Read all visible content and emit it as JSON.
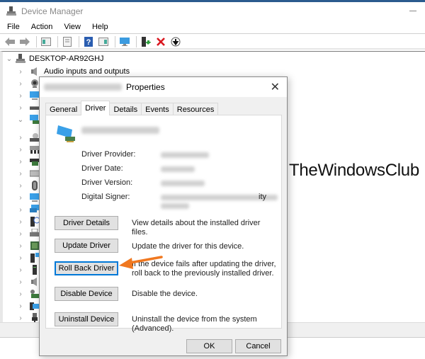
{
  "window": {
    "title": "Device Manager"
  },
  "menu": [
    "File",
    "Action",
    "View",
    "Help"
  ],
  "toolbar": [
    "back-icon",
    "forward-icon",
    "show-hide-console-tree-icon",
    "properties-icon",
    "help-icon",
    "action-pane-icon",
    "scan-hardware-icon",
    "update-driver-icon",
    "uninstall-icon",
    "disable-icon"
  ],
  "tree": {
    "root": "DESKTOP-AR92GHJ",
    "first_item": "Audio inputs and outputs",
    "items": [
      {
        "icon": "audio-icon",
        "expanded": false
      },
      {
        "icon": "camera-icon",
        "expanded": false
      },
      {
        "icon": "monitor-icon",
        "expanded": false
      },
      {
        "icon": "disk-drive-icon",
        "expanded": false
      },
      {
        "icon": "display-adapter-icon",
        "expanded": true
      },
      {
        "icon": "dvd-drive-icon",
        "expanded": false
      },
      {
        "icon": "hid-icon",
        "expanded": false
      },
      {
        "icon": "ide-controller-icon",
        "expanded": false
      },
      {
        "icon": "keyboard-icon",
        "expanded": false
      },
      {
        "icon": "mouse-icon",
        "expanded": false
      },
      {
        "icon": "monitors-icon",
        "expanded": false
      },
      {
        "icon": "network-adapter-icon",
        "expanded": false
      },
      {
        "icon": "other-devices-icon",
        "expanded": false
      },
      {
        "icon": "print-queue-icon",
        "expanded": false
      },
      {
        "icon": "processor-icon",
        "expanded": false
      },
      {
        "icon": "security-device-icon",
        "expanded": false
      },
      {
        "icon": "software-device-icon",
        "expanded": false
      },
      {
        "icon": "sound-icon",
        "expanded": false
      },
      {
        "icon": "storage-controller-icon",
        "expanded": false
      },
      {
        "icon": "system-device-icon",
        "expanded": false
      },
      {
        "icon": "usb-controller-icon",
        "expanded": false
      }
    ]
  },
  "dialog": {
    "title_suffix": "Properties",
    "tabs": [
      "General",
      "Driver",
      "Details",
      "Events",
      "Resources"
    ],
    "active_tab": "Driver",
    "props": [
      {
        "label": "Driver Provider:"
      },
      {
        "label": "Driver Date:"
      },
      {
        "label": "Driver Version:"
      },
      {
        "label": "Digital Signer:",
        "visible_tail": "ity"
      }
    ],
    "buttons": [
      {
        "label": "Driver Details",
        "desc": "View details about the installed driver files."
      },
      {
        "label": "Update Driver",
        "desc": "Update the driver for this device."
      },
      {
        "label": "Roll Back Driver",
        "desc": "If the device fails after updating the driver, roll back to the previously installed driver."
      },
      {
        "label": "Disable Device",
        "desc": "Disable the device."
      },
      {
        "label": "Uninstall Device",
        "desc": "Uninstall the device from the system (Advanced)."
      }
    ],
    "ok": "OK",
    "cancel": "Cancel"
  },
  "watermark": {
    "text": "TheWindowsClub"
  },
  "colors": {
    "accent": "#0078d7",
    "arrow": "#f07820",
    "titlebar": "#2b5b8e"
  }
}
